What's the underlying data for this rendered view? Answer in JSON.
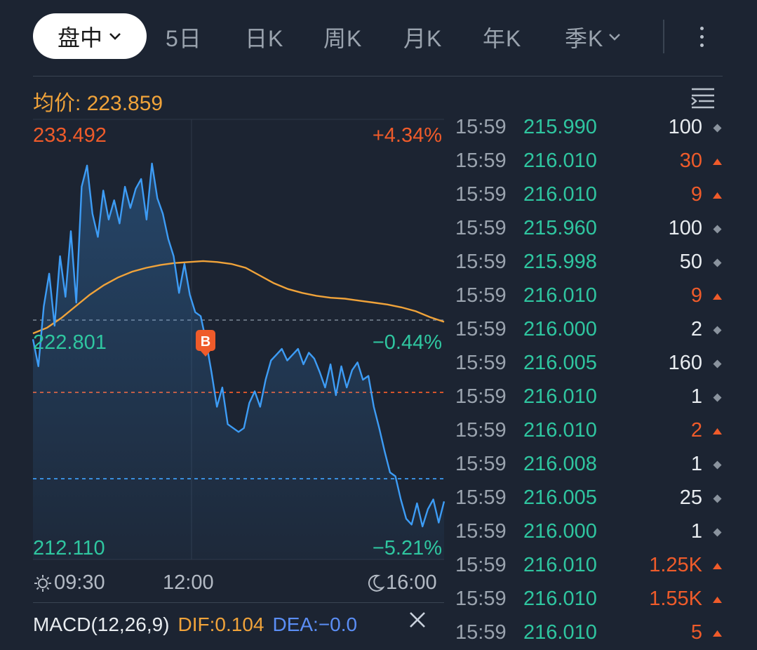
{
  "tabs": {
    "active": "盘中",
    "items": [
      "5日",
      "日K",
      "周K",
      "月K",
      "年K",
      "季K"
    ]
  },
  "avg_label": "均价: 223.859",
  "chart": {
    "high_price": "233.492",
    "high_pct": "+4.34%",
    "ref_price": "222.801",
    "ref_pct": "−0.44%",
    "low_price": "212.110",
    "low_pct": "−5.21%",
    "marker": "B",
    "time_start": "09:30",
    "time_mid": "12:00",
    "time_end": "16:00"
  },
  "chart_data": {
    "type": "line",
    "ylim": [
      212.11,
      233.492
    ],
    "reference": 222.801,
    "x_ticks": [
      "09:30",
      "12:00",
      "16:00"
    ],
    "series": [
      {
        "values": [
          222.9,
          221.5,
          224.6,
          226.3,
          223.6,
          227.2,
          225.1,
          228.5,
          224.8,
          230.8,
          231.9,
          229.4,
          228.2,
          230.6,
          229.1,
          230.1,
          228.9,
          230.8,
          229.7,
          230.7,
          231.2,
          229.1,
          232.0,
          230.2,
          229.4,
          228.1,
          227.2,
          225.3,
          226.8,
          225.2,
          224.3,
          224.1,
          222.8,
          221.2,
          219.4,
          220.4,
          218.5,
          218.3,
          218.1,
          218.3,
          219.6,
          220.2,
          219.4,
          220.8,
          221.8,
          222.1,
          222.4,
          221.8,
          222.1,
          222.4,
          221.6,
          222.2,
          221.9,
          221.2,
          220.4,
          221.6,
          220.0,
          221.5,
          220.4,
          221.3,
          221.7,
          220.8,
          221.0,
          219.4,
          218.3,
          217.1,
          216.0,
          215.8,
          214.6,
          213.6,
          213.3,
          214.4,
          213.2,
          214.1,
          214.6,
          213.4,
          214.5
        ]
      },
      {
        "name": "均价",
        "values": [
          223.2,
          223.5,
          224.0,
          224.6,
          225.2,
          225.7,
          226.1,
          226.4,
          226.6,
          226.75,
          226.85,
          226.9,
          226.95,
          226.9,
          226.8,
          226.6,
          226.2,
          225.8,
          225.5,
          225.3,
          225.15,
          225.05,
          225.0,
          224.9,
          224.8,
          224.7,
          224.55,
          224.35,
          224.05,
          223.8
        ]
      }
    ]
  },
  "macd": {
    "name": "MACD(12,26,9)",
    "dif": "DIF:0.104",
    "dea": "DEA:−0.0"
  },
  "colors": {
    "background": "#1c2432",
    "price_line": "#3d9cf5",
    "avg_line": "#f0a33a",
    "up": "#ef5b2a",
    "neutral_price": "#2fc6a0"
  },
  "ticks": [
    {
      "time": "15:59",
      "price": "215.990",
      "vol": "100",
      "dir": "flat"
    },
    {
      "time": "15:59",
      "price": "216.010",
      "vol": "30",
      "dir": "up"
    },
    {
      "time": "15:59",
      "price": "216.010",
      "vol": "9",
      "dir": "up"
    },
    {
      "time": "15:59",
      "price": "215.960",
      "vol": "100",
      "dir": "flat"
    },
    {
      "time": "15:59",
      "price": "215.998",
      "vol": "50",
      "dir": "flat"
    },
    {
      "time": "15:59",
      "price": "216.010",
      "vol": "9",
      "dir": "up"
    },
    {
      "time": "15:59",
      "price": "216.000",
      "vol": "2",
      "dir": "flat"
    },
    {
      "time": "15:59",
      "price": "216.005",
      "vol": "160",
      "dir": "flat"
    },
    {
      "time": "15:59",
      "price": "216.010",
      "vol": "1",
      "dir": "flat"
    },
    {
      "time": "15:59",
      "price": "216.010",
      "vol": "2",
      "dir": "up"
    },
    {
      "time": "15:59",
      "price": "216.008",
      "vol": "1",
      "dir": "flat"
    },
    {
      "time": "15:59",
      "price": "216.005",
      "vol": "25",
      "dir": "flat"
    },
    {
      "time": "15:59",
      "price": "216.000",
      "vol": "1",
      "dir": "flat"
    },
    {
      "time": "15:59",
      "price": "216.010",
      "vol": "1.25K",
      "dir": "up"
    },
    {
      "time": "15:59",
      "price": "216.010",
      "vol": "1.55K",
      "dir": "up"
    },
    {
      "time": "15:59",
      "price": "216.010",
      "vol": "5",
      "dir": "up"
    }
  ]
}
